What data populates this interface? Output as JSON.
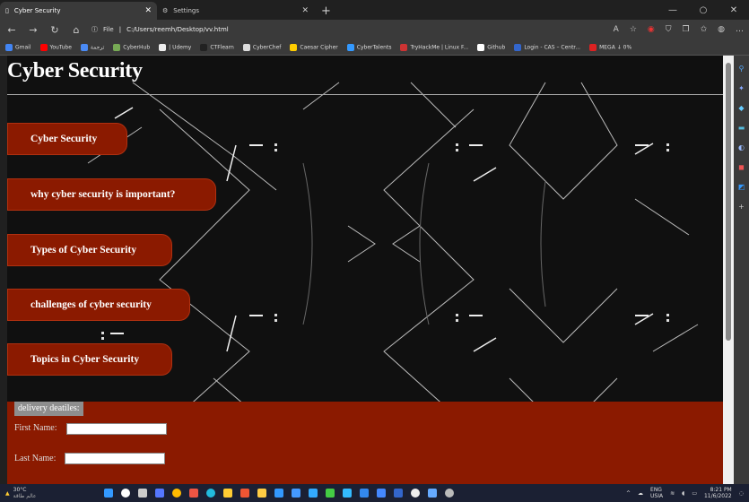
{
  "browser": {
    "tabs": [
      {
        "title": "Cyber Security",
        "active": true
      },
      {
        "title": "Settings",
        "active": false
      }
    ],
    "address": {
      "prefix": "File",
      "url": "C:/Users/reemh/Desktop/vv.html"
    },
    "bookmarks": [
      "Gmail",
      "YouTube",
      "ترجمة",
      "CyberHub",
      "| Udemy",
      "CTFlearn",
      "CyberChef",
      "Caesar Cipher",
      "CyberTalents",
      "TryHackMe | Linux F...",
      "Github",
      "Login - CAS – Centr...",
      "MEGA ↓ 0%"
    ]
  },
  "page": {
    "title": "Cyber Security",
    "nav": [
      "Cyber Security",
      "why cyber security is important?",
      "Types of Cyber Security",
      "challenges of cyber security",
      "Topics in Cyber Security"
    ],
    "form": {
      "legend": "delivery deatiles:",
      "first_name_label": "First Name:",
      "last_name_label": "Last Name:"
    }
  },
  "taskbar": {
    "temperature": "30°C",
    "weather_text": "عالم طاقة",
    "lang": "ENG",
    "lang2": "USIA",
    "time": "8:21 PM",
    "date": "11/6/2022"
  },
  "colors": {
    "accent": "#8b1a00",
    "legend": "#8e8e8e"
  }
}
